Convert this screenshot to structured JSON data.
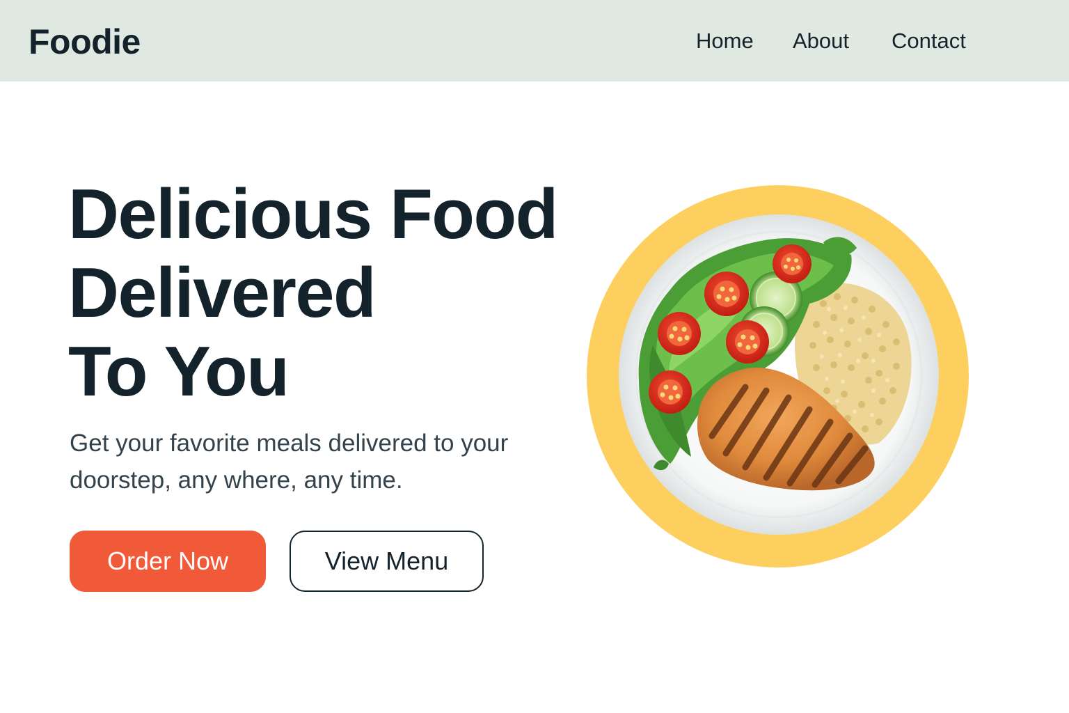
{
  "header": {
    "logo": "Foodie",
    "nav": [
      {
        "label": "Home"
      },
      {
        "label": "About"
      },
      {
        "label": "Contact"
      }
    ]
  },
  "hero": {
    "title_lines": [
      "Delicious Food",
      "Delivered",
      "To You"
    ],
    "subtitle": "Get your favorite meals delivered to your doorstep, any where, any time.",
    "primary_button": "Order Now",
    "secondary_button": "View Menu"
  },
  "image": {
    "subject": "plate-with-grilled-chicken-salad-and-couscous-icon"
  },
  "colors": {
    "header_bg": "#dfe9e2",
    "text_dark": "#13222b",
    "text_muted": "#33424b",
    "accent_orange": "#f05a38",
    "plate_ring_yellow": "#fdcf5f"
  }
}
